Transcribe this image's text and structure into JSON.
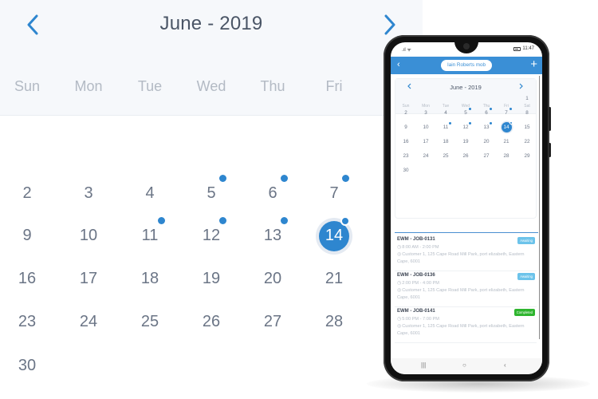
{
  "big_calendar": {
    "title": "June - 2019",
    "prev_icon": "chevron-left-icon",
    "next_icon": "chevron-right-icon",
    "weekdays": [
      "Sun",
      "Mon",
      "Tue",
      "Wed",
      "Thu",
      "Fri"
    ],
    "rows": [
      [
        {
          "d": "2"
        },
        {
          "d": "3"
        },
        {
          "d": "4"
        },
        {
          "d": "5",
          "event": true
        },
        {
          "d": "6",
          "event": true
        },
        {
          "d": "7",
          "event": true
        }
      ],
      [
        {
          "d": "9"
        },
        {
          "d": "10"
        },
        {
          "d": "11",
          "event": true
        },
        {
          "d": "12",
          "event": true
        },
        {
          "d": "13",
          "event": true
        },
        {
          "d": "14",
          "event": true,
          "selected": true
        }
      ],
      [
        {
          "d": "16"
        },
        {
          "d": "17"
        },
        {
          "d": "18"
        },
        {
          "d": "19"
        },
        {
          "d": "20"
        },
        {
          "d": "21"
        }
      ],
      [
        {
          "d": "23"
        },
        {
          "d": "24"
        },
        {
          "d": "25"
        },
        {
          "d": "26"
        },
        {
          "d": "27"
        },
        {
          "d": "28"
        }
      ],
      [
        {
          "d": "30"
        }
      ]
    ]
  },
  "phone": {
    "status_bar": {
      "signal": "signal-wifi-icon",
      "time": "11:47",
      "battery": "battery-icon"
    },
    "app_bar": {
      "back": "‹",
      "title": "Iain Roberts mob",
      "add": "+"
    },
    "calendar": {
      "title": "June - 2019",
      "weekdays": [
        "Sun",
        "Mon",
        "Tue",
        "Wed",
        "Thu",
        "Fri",
        "Sat"
      ],
      "weeks": [
        [
          null,
          null,
          null,
          null,
          null,
          null,
          {
            "d": "1"
          }
        ],
        [
          {
            "d": "2"
          },
          {
            "d": "3"
          },
          {
            "d": "4"
          },
          {
            "d": "5",
            "event": true
          },
          {
            "d": "6",
            "event": true
          },
          {
            "d": "7",
            "event": true
          },
          {
            "d": "8"
          }
        ],
        [
          {
            "d": "9"
          },
          {
            "d": "10"
          },
          {
            "d": "11",
            "event": true
          },
          {
            "d": "12",
            "event": true
          },
          {
            "d": "13",
            "event": true
          },
          {
            "d": "14",
            "event": true,
            "selected": true
          },
          {
            "d": "15"
          }
        ],
        [
          {
            "d": "16"
          },
          {
            "d": "17"
          },
          {
            "d": "18"
          },
          {
            "d": "19"
          },
          {
            "d": "20"
          },
          {
            "d": "21"
          },
          {
            "d": "22"
          }
        ],
        [
          {
            "d": "23"
          },
          {
            "d": "24"
          },
          {
            "d": "25"
          },
          {
            "d": "26"
          },
          {
            "d": "27"
          },
          {
            "d": "28"
          },
          {
            "d": "29"
          }
        ],
        [
          {
            "d": "30"
          }
        ]
      ]
    },
    "jobs": [
      {
        "id": "EWM - JOB-0131",
        "time": "8:00 AM - 2:00 PM",
        "address": "Customer 1, 125 Cape Road Mill Park, port elizabeth, Eastern Cape, 6001",
        "status": "Awaiting",
        "status_color": "#6cc3ea"
      },
      {
        "id": "EWM - JOB-0136",
        "time": "2:00 PM - 4:00 PM",
        "address": "Customer 1, 125 Cape Road Mill Park, port elizabeth, Eastern Cape, 6001",
        "status": "Awaiting",
        "status_color": "#6cc3ea"
      },
      {
        "id": "EWM - JOB-0141",
        "time": "5:00 PM - 7:00 PM",
        "address": "Customer 1, 125 Cape Road Mill Park, port elizabeth, Eastern Cape, 6001",
        "status": "Completed",
        "status_color": "#2fb52f"
      }
    ],
    "nav_bar": {
      "recents": "|||",
      "home": "○",
      "back": "‹"
    }
  },
  "colors": {
    "accent": "#2e86cf",
    "app_bar": "#3a8fd6",
    "header_bg": "#f6f8fb"
  }
}
